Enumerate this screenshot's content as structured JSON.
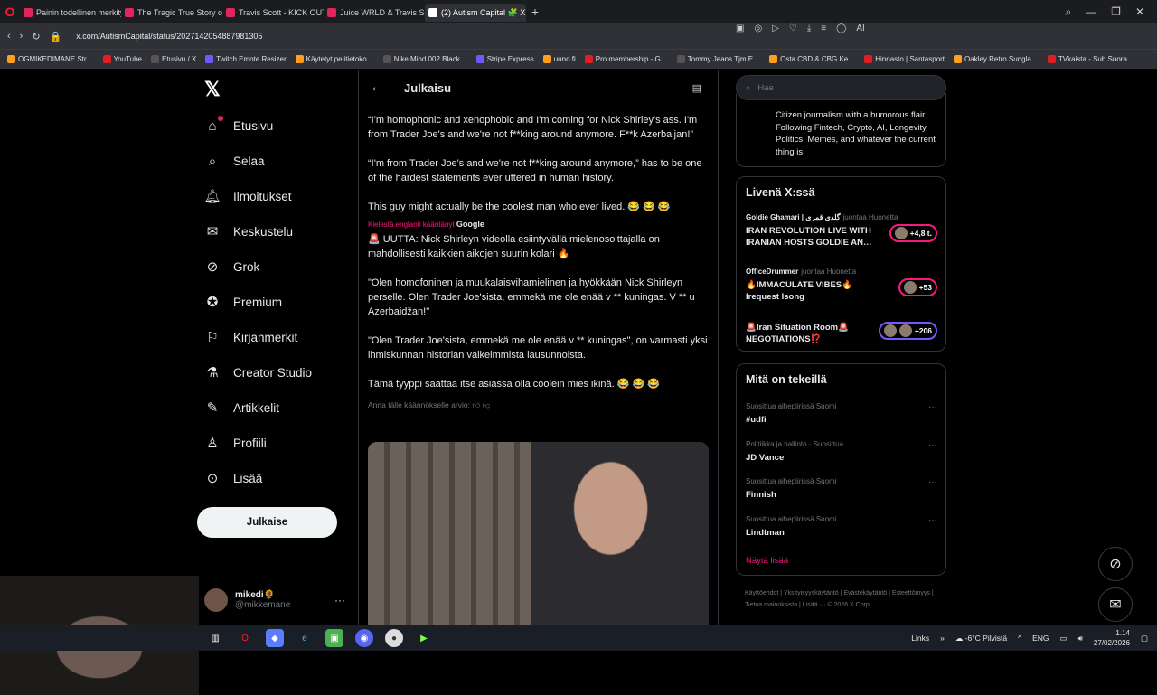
{
  "browser": {
    "tabs": [
      {
        "title": "Painin todellinen merkity…",
        "active": false
      },
      {
        "title": "The Tragic True Story of Ju…",
        "active": false
      },
      {
        "title": "Travis Scott - KICK OUT -…",
        "active": false
      },
      {
        "title": "Juice WRLD & Travis Scott…",
        "active": false
      },
      {
        "title": "(2) Autism Capital 🧩 X…",
        "active": true
      }
    ],
    "url": "x.com/AutismCapital/status/2027142054887981305",
    "bookmarks": [
      "OGMIKEDIMANE Str…",
      "YouTube",
      "Etusivu / X",
      "Twitch Emote Resizer",
      "Käytetyt pelitietoko…",
      "Nike Mind 002 Black…",
      "Stripe Express",
      "uuno.fi",
      "Pro membership - G…",
      "Tommy Jeans Tjm E…",
      "Osta CBD & CBG Ke…",
      "Hinnasto | Santasport",
      "Oakley Retro Sungla…",
      "TVkaista - Sub Suora"
    ]
  },
  "nav": {
    "items": [
      {
        "label": "Etusivu",
        "icon": "home-icon"
      },
      {
        "label": "Selaa",
        "icon": "search-icon"
      },
      {
        "label": "Ilmoitukset",
        "icon": "bell-icon"
      },
      {
        "label": "Keskustelu",
        "icon": "mail-icon"
      },
      {
        "label": "Grok",
        "icon": "grok-icon"
      },
      {
        "label": "Premium",
        "icon": "verified-icon"
      },
      {
        "label": "Kirjanmerkit",
        "icon": "bookmark-icon"
      },
      {
        "label": "Creator Studio",
        "icon": "flask-icon"
      },
      {
        "label": "Artikkelit",
        "icon": "article-icon"
      },
      {
        "label": "Profiili",
        "icon": "person-icon"
      },
      {
        "label": "Lisää",
        "icon": "more-circle-icon"
      }
    ],
    "post_button": "Julkaise",
    "user": {
      "name": "mikedi🌻",
      "handle": "@mikkemane"
    }
  },
  "post": {
    "header": "Julkaisu",
    "original": [
      "“I'm homophonic and xenophobic and I'm coming for Nick Shirley's ass. I'm from Trader Joe's and we're not f**king around anymore. F**k Azerbaijan!”",
      "“I'm from Trader Joe's and we're not f**king around anymore,” has to be one of the hardest statements ever uttered in human history.",
      "This guy might actually be the coolest man who ever lived. 😂 😂 😂"
    ],
    "translated_note": "Kielestä englanti kääntänyt",
    "translator": "Google",
    "translated": [
      "🚨 UUTTA: Nick Shirleyn videolla esiintyvällä mielenosoittajalla on mahdollisesti kaikkien aikojen suurin kolari 🔥",
      "\"Olen homofoninen ja muukalaisvihamielinen ja hyökkään Nick Shirleyn perselle. Olen Trader Joe'sista, emmekä me ole enää v ** kuningas. V ** u Azerbaidžan!\"",
      "\"Olen Trader Joe'sista, emmekä me ole enää v ** kuningas\", on varmasti yksi ihmiskunnan historian vaikeimmista lausunnoista.",
      "Tämä tyyppi saattaa itse asiassa olla coolein mies ikinä. 😂 😂 😂"
    ],
    "rate_prompt": "Anna tälle käännökselle arvio:"
  },
  "sidebar": {
    "search_placeholder": "Hae",
    "bio": "Citizen journalism with a humorous flair. Following Fintech, Crypto, AI, Longevity, Politics, Memes, and whatever the current thing is.",
    "live_title": "Livenä X:ssä",
    "live": [
      {
        "host": "Goldie Ghamari | گلدی قمری",
        "role": "juontaa Huonetta",
        "title": "IRAN REVOLUTION LIVE WITH IRANIAN HOSTS GOLDIE AN…",
        "count": "+4,8 t."
      },
      {
        "host": "OfficeDrummer",
        "role": "juontaa Huonetta",
        "title": "🔥IMMACULATE VIBES🔥 Irequest Isong",
        "count": "+53"
      },
      {
        "host": "",
        "role": "",
        "title": "🚨Iran Situation Room🚨 NEGOTIATIONS⁉️",
        "count": "+206"
      }
    ],
    "trends_title": "Mitä on tekeillä",
    "trends": [
      {
        "context": "Suosittua aihepiirissä Suomi",
        "name": "#udfi"
      },
      {
        "context": "Politiikka ja hallinto · Suosittua",
        "name": "JD Vance"
      },
      {
        "context": "Suosittua aihepiirissä Suomi",
        "name": "Finnish"
      },
      {
        "context": "Suosittua aihepiirissä Suomi",
        "name": "Lindtman"
      }
    ],
    "show_more": "Näytä lisää",
    "footer": "Käyttöehdot | Yksityisyyskäytäntö | Evästekäytäntö | Esteettömyys | Tietoa mainoksista | Lisää ··· © 2026 X Corp."
  },
  "taskbar": {
    "links": "Links",
    "weather": "-6°C Pilvistä",
    "lang": "ENG",
    "time": "1.14",
    "date": "27/02/2026"
  }
}
